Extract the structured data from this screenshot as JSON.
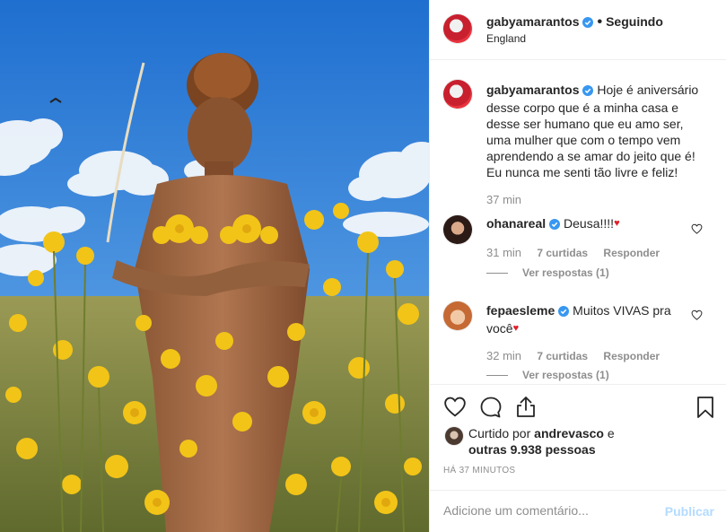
{
  "post": {
    "username": "gabyamarantos",
    "follow_status": "Seguindo",
    "location": "England"
  },
  "caption": {
    "username": "gabyamarantos",
    "lines": [
      "Hoje é aniversário",
      "desse corpo que é a minha casa e",
      "desse ser humano que eu amo ser,",
      "uma mulher que com o tempo vem",
      "aprendendo a se amar do jeito que é!",
      "Eu nunca me senti tão livre e feliz!"
    ],
    "time": "37 min"
  },
  "comments": [
    {
      "username": "ohanareal",
      "text_line1": "Deusa!!!!",
      "text_line2": "",
      "time": "31 min",
      "likes": "7 curtidas",
      "reply": "Responder",
      "view_replies": "Ver respostas (1)"
    },
    {
      "username": "fepaesleme",
      "text_line1": "Muitos VIVAS pra",
      "text_line2": "você",
      "time": "32 min",
      "likes": "7 curtidas",
      "reply": "Responder",
      "view_replies": "Ver respostas (1)"
    }
  ],
  "likes": {
    "prefix": "Curtido por",
    "first_user": "andrevasco",
    "connector": "e",
    "others": "outras 9.938 pessoas"
  },
  "timestamp": "HÁ 37 MINUTOS",
  "comment_box": {
    "placeholder": "Adicione um comentário...",
    "publish_label": "Publicar"
  },
  "icons": {
    "like": "heart-outline-icon",
    "comment": "speech-bubble-icon",
    "share": "share-arrow-icon",
    "save": "bookmark-icon",
    "verified": "verified-badge-icon"
  },
  "colors": {
    "verified_blue": "#3897f0",
    "text": "#262626",
    "muted": "#8e8e8e",
    "publish_disabled": "#b3dbff",
    "emoji_heart": "#e0202a"
  }
}
